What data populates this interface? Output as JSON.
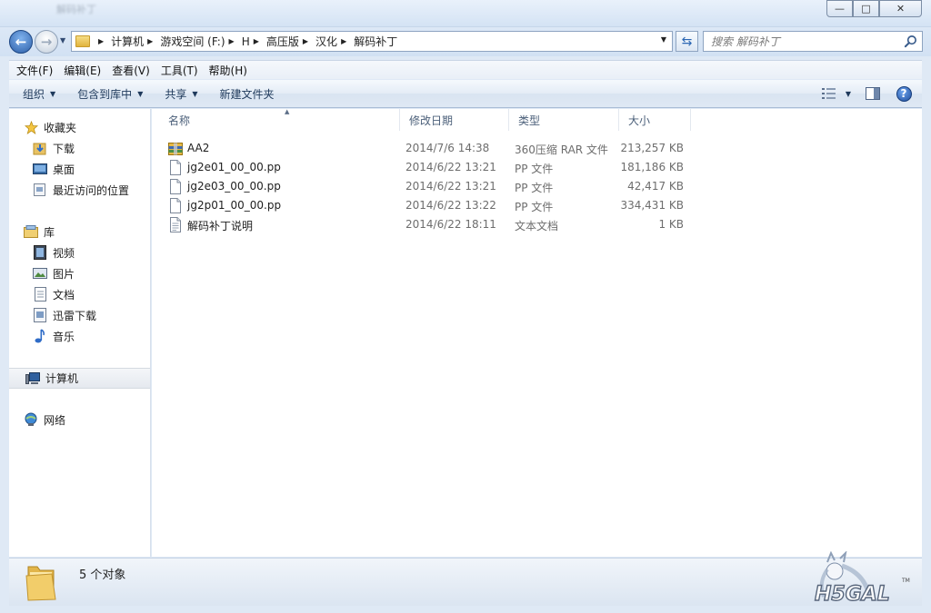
{
  "window": {
    "title": "解码补丁",
    "controls": {
      "minimize": "—",
      "maximize": "□",
      "close": "✕"
    }
  },
  "address": {
    "crumbs": [
      "计算机",
      "游戏空间 (F:)",
      "H",
      "高压版",
      "汉化",
      "解码补丁"
    ]
  },
  "search": {
    "placeholder": "搜索 解码补丁"
  },
  "menu": [
    "文件(F)",
    "编辑(E)",
    "查看(V)",
    "工具(T)",
    "帮助(H)"
  ],
  "toolbar": {
    "organize": "组织",
    "include_in_library": "包含到库中",
    "share": "共享",
    "new_folder": "新建文件夹"
  },
  "nav": {
    "favorites": "收藏夹",
    "downloads": "下载",
    "desktop": "桌面",
    "recent": "最近访问的位置",
    "libraries": "库",
    "videos": "视频",
    "pictures": "图片",
    "documents": "文档",
    "thunder": "迅雷下载",
    "music": "音乐",
    "computer": "计算机",
    "network": "网络"
  },
  "columns": {
    "name": "名称",
    "modified": "修改日期",
    "type": "类型",
    "size": "大小"
  },
  "files": [
    {
      "name": "AA2",
      "modified": "2014/7/6 14:38",
      "type": "360压缩 RAR 文件",
      "size": "213,257 KB",
      "icon": "rar-archive-icon"
    },
    {
      "name": "jg2e01_00_00.pp",
      "modified": "2014/6/22 13:21",
      "type": "PP 文件",
      "size": "181,186 KB",
      "icon": "file-icon"
    },
    {
      "name": "jg2e03_00_00.pp",
      "modified": "2014/6/22 13:21",
      "type": "PP 文件",
      "size": "42,417 KB",
      "icon": "file-icon"
    },
    {
      "name": "jg2p01_00_00.pp",
      "modified": "2014/6/22 13:22",
      "type": "PP 文件",
      "size": "334,431 KB",
      "icon": "file-icon"
    },
    {
      "name": "解码补丁说明",
      "modified": "2014/6/22 18:11",
      "type": "文本文档",
      "size": "1 KB",
      "icon": "text-document-icon"
    }
  ],
  "status": {
    "count": "5 个对象"
  },
  "watermark": {
    "logo_text": "H5GAL",
    "tm": "TM"
  },
  "colors": {
    "accent": "#1e395b",
    "window_bg": "#dfe9f5",
    "header_text": "#4c607a"
  }
}
